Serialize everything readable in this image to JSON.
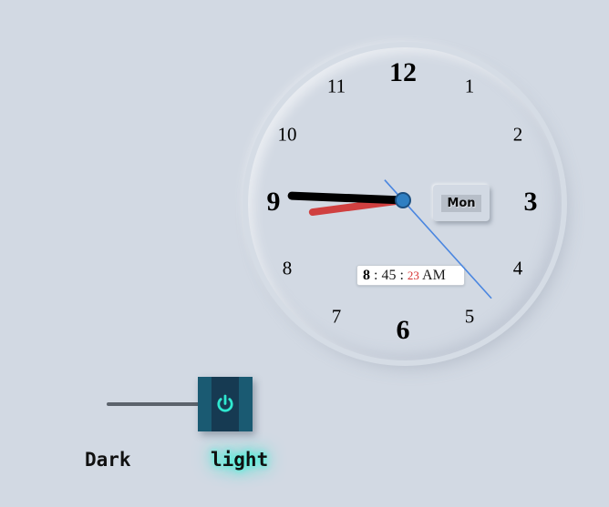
{
  "clock": {
    "numbers": [
      "12",
      "1",
      "2",
      "3",
      "4",
      "5",
      "6",
      "7",
      "8",
      "9",
      "10",
      "11"
    ],
    "hour": 8,
    "minute": 45,
    "second": 23,
    "day": "Mon",
    "digital": {
      "hour": "8",
      "sep1": " : ",
      "minute": "45",
      "sep2": " : ",
      "second": "23",
      "ampm": " AM"
    },
    "colors": {
      "hour_hand": "#d04040",
      "minute_hand": "#000000",
      "second_hand": "#4a86e0",
      "center_dot": "#2f7fc2"
    }
  },
  "theme_toggle": {
    "dark_label": "Dark",
    "light_label": "light",
    "state": "light",
    "icon": "power-icon",
    "glow_color": "#2fe8d0"
  }
}
